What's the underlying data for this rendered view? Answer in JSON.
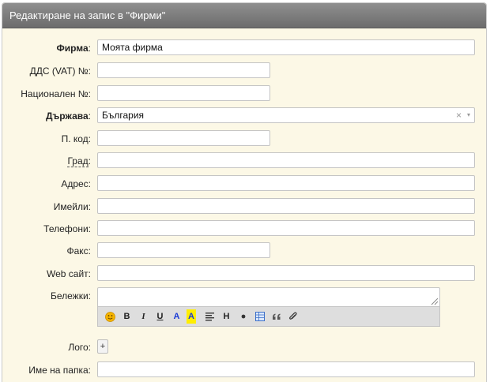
{
  "window": {
    "title": "Редактиране на запис в \"Фирми\""
  },
  "form": {
    "company": {
      "label": "Фирма",
      "colon": ":",
      "value": "Моята фирма"
    },
    "vat": {
      "label": "ДДС (VAT) №:",
      "value": ""
    },
    "national_no": {
      "label": "Национален №:",
      "value": ""
    },
    "country": {
      "label": "Държава",
      "colon": ":",
      "value": "България",
      "clear": "×",
      "arrow": "▾"
    },
    "postal_code": {
      "label": "П. код:",
      "value": ""
    },
    "city": {
      "label": "Град",
      "colon": ":",
      "value": ""
    },
    "address": {
      "label": "Адрес:",
      "value": ""
    },
    "emails": {
      "label": "Имейли:",
      "value": ""
    },
    "phones": {
      "label": "Телефони:",
      "value": ""
    },
    "fax": {
      "label": "Факс:",
      "value": ""
    },
    "website": {
      "label": "Web сайт:",
      "value": ""
    },
    "notes": {
      "label": "Бележки:",
      "value": ""
    },
    "logo": {
      "label": "Лого:",
      "button": "+"
    },
    "folder_name": {
      "label": "Име на папка:",
      "value": ""
    }
  },
  "editor_toolbar": {
    "bold": "B",
    "italic": "I",
    "underline": "U",
    "font_color": "A",
    "highlight": "A",
    "heading": "H",
    "icons": [
      "smiley-icon",
      "align-icon",
      "bullet-list-icon",
      "table-icon",
      "quote-icon",
      "attachment-icon"
    ]
  },
  "colors": {
    "panel_bg": "#fcf8e6",
    "titlebar": "#7a7a7a",
    "highlight": "#ffee00",
    "link_blue": "#1a3bd6"
  }
}
